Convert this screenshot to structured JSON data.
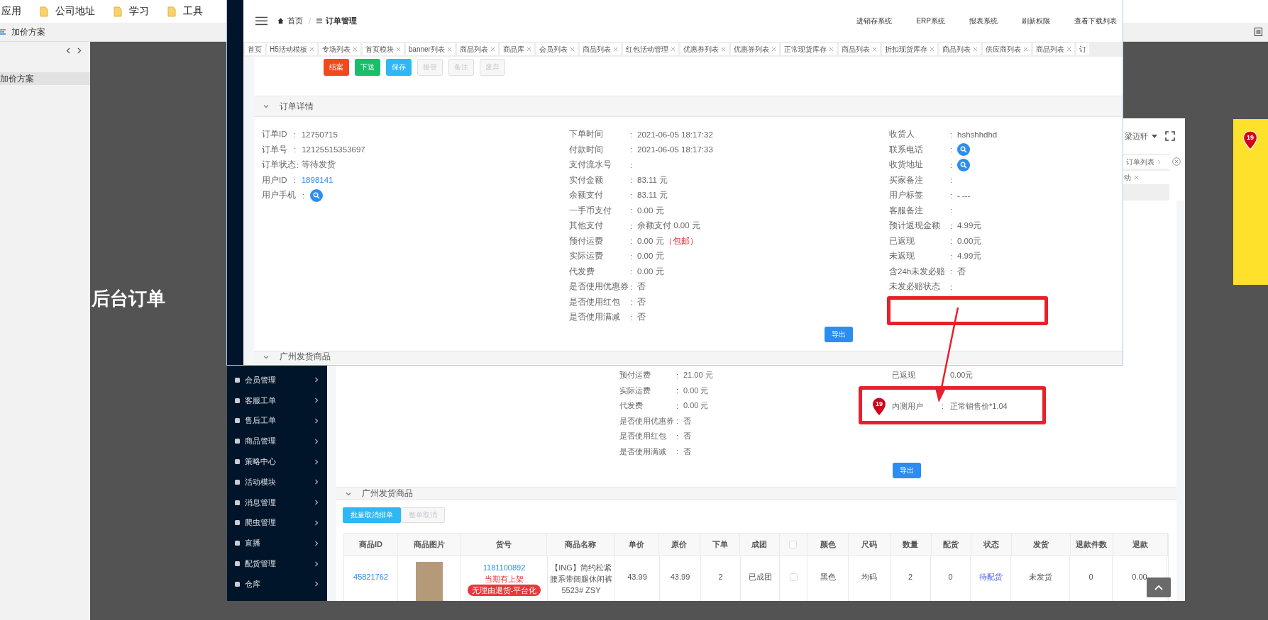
{
  "bookmarks_bar": {
    "items": [
      {
        "label": "应用",
        "kind": "apps"
      },
      {
        "label": "公司地址",
        "kind": "folder"
      },
      {
        "label": "学习",
        "kind": "folder"
      },
      {
        "label": "工具",
        "kind": "folder"
      }
    ]
  },
  "doc_bar": {
    "title": "加价方案"
  },
  "doc_sidebar": {
    "items": [
      {
        "label": "加价方案",
        "selected": true
      }
    ]
  },
  "canvas": {
    "heading": "后台订单"
  },
  "back_screenshot": {
    "user_name": "梁迈轩",
    "tabs": [
      {
        "label": "订单列表",
        "kind": "arrow"
      },
      {
        "label": "动",
        "kind": "closable"
      }
    ],
    "sidebar": [
      {
        "label": "会员管理"
      },
      {
        "label": "客服工单"
      },
      {
        "label": "售后工单"
      },
      {
        "label": "商品管理"
      },
      {
        "label": "策略中心"
      },
      {
        "label": "活动模块"
      },
      {
        "label": "消息管理"
      },
      {
        "label": "爬虫管理"
      },
      {
        "label": "直播"
      },
      {
        "label": "配货管理"
      },
      {
        "label": "仓库"
      }
    ],
    "left_fields": [
      {
        "label": "预付运费",
        "sep": ":",
        "value": "21.00 元"
      },
      {
        "label": "实际运费",
        "sep": ":",
        "value": "0.00 元"
      },
      {
        "label": "代发费",
        "sep": ":",
        "value": "0.00 元"
      },
      {
        "label": "是否使用优惠券",
        "sep": ":",
        "value": "否"
      },
      {
        "label": "是否使用红包",
        "sep": ":",
        "value": "否"
      },
      {
        "label": "是否使用满减",
        "sep": ":",
        "value": "否"
      }
    ],
    "right_fields": [
      {
        "label": "已返现",
        "value": "0.00元",
        "kind": "plain"
      },
      {
        "label": "内测用户",
        "sep": ":",
        "value": "正常销售价*1.04",
        "kind": "pinned",
        "pin": "19"
      }
    ],
    "export_button": "导出",
    "goods_section": {
      "title": "广州发货商品",
      "expanded": true
    },
    "goods_buttons": [
      {
        "label": "批量取消排单",
        "kind": "info"
      },
      {
        "label": "整单取消",
        "kind": "disabled"
      }
    ],
    "table": {
      "columns": [
        {
          "kind": "text",
          "label": "商品ID"
        },
        {
          "kind": "text",
          "label": "商品图片"
        },
        {
          "kind": "text",
          "label": "货号"
        },
        {
          "kind": "text",
          "label": "商品名称"
        },
        {
          "kind": "text",
          "label": "单价"
        },
        {
          "kind": "text",
          "label": "原价"
        },
        {
          "kind": "text",
          "label": "下单"
        },
        {
          "kind": "text",
          "label": "成团"
        },
        {
          "kind": "checkbox",
          "checked": false
        },
        {
          "kind": "text",
          "label": "颜色"
        },
        {
          "kind": "text",
          "label": "尺码"
        },
        {
          "kind": "text",
          "label": "数量"
        },
        {
          "kind": "text",
          "label": "配货"
        },
        {
          "kind": "text",
          "label": "状态"
        },
        {
          "kind": "text",
          "label": "发货"
        },
        {
          "kind": "text",
          "label": "退款件数"
        },
        {
          "kind": "text",
          "label": "退款"
        }
      ],
      "rows": [
        {
          "cells": [
            {
              "kind": "link",
              "text": "45821762"
            },
            {
              "kind": "photo"
            },
            {
              "kind": "sku",
              "code": "1181100892",
              "status": "当期有上架",
              "tag": "无理由退货-平台化"
            },
            {
              "kind": "text",
              "text": "【ING】简约松紧腰系带阔腿休闲裤 5523# ZSY"
            },
            {
              "kind": "text",
              "text": "43.99"
            },
            {
              "kind": "text",
              "text": "43.99"
            },
            {
              "kind": "text",
              "text": "2"
            },
            {
              "kind": "text",
              "text": "已成团"
            },
            {
              "kind": "checkbox",
              "checked": false
            },
            {
              "kind": "text",
              "text": "黑色"
            },
            {
              "kind": "text",
              "text": "均码"
            },
            {
              "kind": "text",
              "text": "2"
            },
            {
              "kind": "text",
              "text": "0"
            },
            {
              "kind": "status",
              "text": "待配货"
            },
            {
              "kind": "text",
              "text": "未发货"
            },
            {
              "kind": "text",
              "text": "0"
            },
            {
              "kind": "text",
              "text": "0.00"
            }
          ]
        }
      ]
    }
  },
  "front_screenshot": {
    "breadcrumb": [
      {
        "label": "首页",
        "kind": "home"
      },
      {
        "label": "订单管理",
        "kind": "list"
      }
    ],
    "breadcrumb_separator": "/",
    "header_links": [
      "进销存系统",
      "ERP系统",
      "报表系统",
      "刷新权限",
      "查看下载列表"
    ],
    "tabs": [
      {
        "label": "首页",
        "closable": false
      },
      {
        "label": "H5活动模板",
        "closable": true
      },
      {
        "label": "专场列表",
        "closable": true
      },
      {
        "label": "首页模块",
        "closable": true
      },
      {
        "label": "banner列表",
        "closable": true
      },
      {
        "label": "商品列表",
        "closable": true
      },
      {
        "label": "商品库",
        "closable": true
      },
      {
        "label": "会员列表",
        "closable": true
      },
      {
        "label": "商品列表",
        "closable": true
      },
      {
        "label": "红包活动管理",
        "closable": true
      },
      {
        "label": "优惠券列表",
        "closable": true
      },
      {
        "label": "优惠券列表",
        "closable": true
      },
      {
        "label": "正常现货库存",
        "closable": true
      },
      {
        "label": "商品列表",
        "closable": true
      },
      {
        "label": "折扣现货库存",
        "closable": true
      },
      {
        "label": "商品列表",
        "closable": true
      },
      {
        "label": "供应商列表",
        "closable": true
      },
      {
        "label": "商品列表",
        "closable": true
      },
      {
        "label": "订",
        "closable": false
      }
    ],
    "actions": [
      {
        "label": "结案",
        "kind": "danger"
      },
      {
        "label": "下送",
        "kind": "success"
      },
      {
        "label": "保存",
        "kind": "info"
      },
      {
        "label": "接管",
        "kind": "disabled"
      },
      {
        "label": "备注",
        "kind": "disabled"
      },
      {
        "label": "废弃",
        "kind": "disabled"
      }
    ],
    "detail_section": {
      "title": "订单详情",
      "expanded": true
    },
    "columns": [
      [
        {
          "label": "订单ID",
          "sep": ":",
          "value": "12750715",
          "kind": "text"
        },
        {
          "label": "订单号",
          "sep": ":",
          "value": "12125515353697",
          "kind": "text"
        },
        {
          "label": "订单状态",
          "sep": ":",
          "value": "等待发货",
          "kind": "tight"
        },
        {
          "label": "用户ID",
          "sep": ":",
          "value": "1898141",
          "kind": "link"
        },
        {
          "label": "用户手机",
          "sep": ":",
          "kind": "search"
        }
      ],
      [
        {
          "label": "下单时间",
          "sep": ":",
          "value": "2021-06-05 18:17:32",
          "kind": "text"
        },
        {
          "label": "付款时间",
          "sep": ":",
          "value": "2021-06-05 18:17:33",
          "kind": "text"
        },
        {
          "label": "支付流水号",
          "sep": ":",
          "kind": "text"
        },
        {
          "label": "实付金额",
          "sep": ":",
          "value": "83.11 元",
          "kind": "text"
        },
        {
          "label": "余额支付",
          "sep": ":",
          "value": "83.11 元",
          "kind": "text"
        },
        {
          "label": "一手币支付",
          "sep": ":",
          "value": "0.00 元",
          "kind": "text"
        },
        {
          "label": "其他支付",
          "sep": ":",
          "value": "余额支付 0.00 元",
          "kind": "text"
        },
        {
          "label": "预付运费",
          "sep": ":",
          "value": "0.00 元",
          "note": "（包邮）",
          "kind": "text"
        },
        {
          "label": "实际运费",
          "sep": ":",
          "value": "0.00 元",
          "kind": "text"
        },
        {
          "label": "代发费",
          "sep": ":",
          "value": "0.00 元",
          "kind": "text"
        },
        {
          "label": "是否使用优惠券",
          "sep": ":",
          "value": "否",
          "kind": "text"
        },
        {
          "label": "是否使用红包",
          "sep": ":",
          "value": "否",
          "kind": "text"
        },
        {
          "label": "是否使用满减",
          "sep": ":",
          "value": "否",
          "kind": "text"
        }
      ],
      [
        {
          "label": "收货人",
          "sep": ":",
          "value": "hshshhdhd",
          "kind": "text"
        },
        {
          "label": "联系电话",
          "sep": ":",
          "kind": "search"
        },
        {
          "label": "收货地址",
          "sep": ":",
          "kind": "search"
        },
        {
          "label": "买家备注",
          "sep": ":",
          "kind": "text"
        },
        {
          "label": "用户标签",
          "sep": ":",
          "value": "- ---",
          "kind": "text"
        },
        {
          "label": "客服备注",
          "sep": ":",
          "kind": "text"
        },
        {
          "label": "预计返现金额",
          "sep": ":",
          "value": "4.99元",
          "kind": "text"
        },
        {
          "label": "已返现",
          "sep": ":",
          "value": "0.00元",
          "kind": "text"
        },
        {
          "label": "未返现",
          "sep": ":",
          "value": "4.99元",
          "kind": "text"
        },
        {
          "label": "含24h未发必赔",
          "sep": ":",
          "value": "否",
          "kind": "text"
        },
        {
          "label": "未发必赔状态",
          "sep": ":",
          "kind": "text"
        }
      ]
    ],
    "export_button": "导出",
    "next_section": {
      "title": "广州发货商品",
      "expanded": true
    }
  },
  "sticky_note": {
    "pin": "19"
  }
}
